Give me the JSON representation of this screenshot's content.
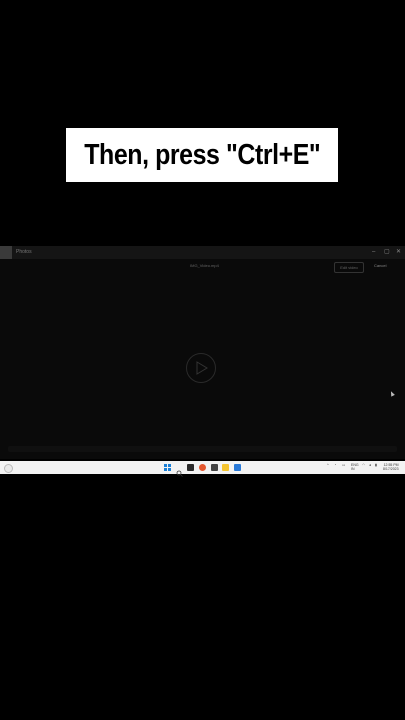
{
  "caption": {
    "text": "Then, press \"Ctrl+E\""
  },
  "window": {
    "title": "Photos",
    "subtitle": "IMG_Video.mp4",
    "edit_label": "Edit video",
    "cancel_label": "Cancel",
    "controls": {
      "minimize": "–",
      "maximize": "▢",
      "close": "✕"
    }
  },
  "taskbar": {
    "weather": "",
    "tray_lang": "ENG IN",
    "clock_time": "12:55 PM",
    "clock_date": "8/17/2023"
  }
}
